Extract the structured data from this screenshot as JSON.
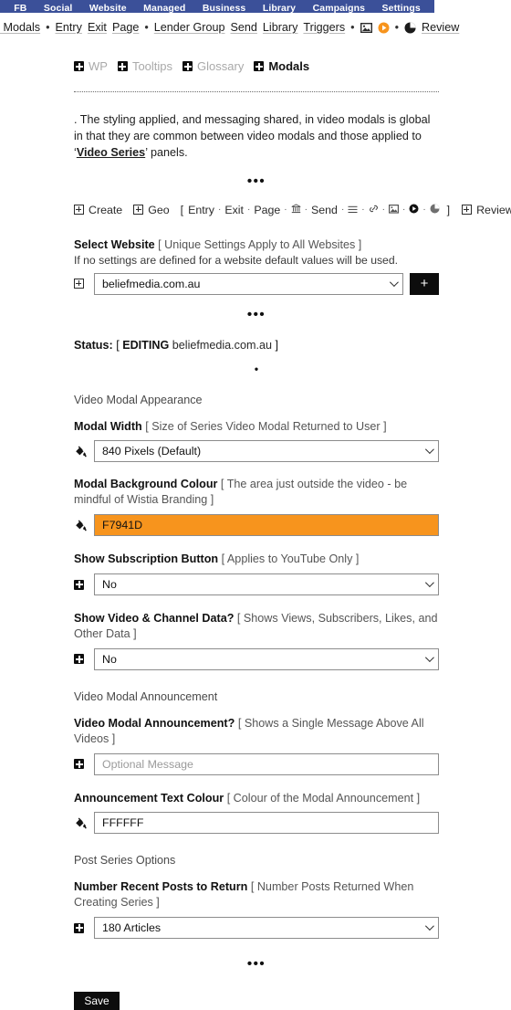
{
  "topnav": {
    "items": [
      "FB",
      "Social",
      "Website",
      "Managed",
      "Business",
      "Library",
      "Campaigns",
      "Settings"
    ]
  },
  "subnav": {
    "items": [
      {
        "type": "link",
        "label": "eo Modals"
      },
      {
        "type": "sep",
        "label": "•"
      },
      {
        "type": "link",
        "label": "Entry"
      },
      {
        "type": "link",
        "label": "Exit"
      },
      {
        "type": "link",
        "label": "Page"
      },
      {
        "type": "sep",
        "label": "•"
      },
      {
        "type": "link",
        "label": "Lender Group"
      },
      {
        "type": "link",
        "label": "Send"
      },
      {
        "type": "link",
        "label": "Library"
      },
      {
        "type": "link",
        "label": "Triggers"
      },
      {
        "type": "sep",
        "label": "•"
      },
      {
        "type": "icon",
        "label": "image-icon"
      },
      {
        "type": "icon",
        "label": "play-circle-icon"
      },
      {
        "type": "sep",
        "label": "•"
      },
      {
        "type": "icon",
        "label": "pie-chart-icon"
      },
      {
        "type": "link",
        "label": "Review"
      }
    ]
  },
  "tabs": [
    {
      "label": "WP",
      "active": false
    },
    {
      "label": "Tooltips",
      "active": false
    },
    {
      "label": "Glossary",
      "active": false
    },
    {
      "label": "Modals",
      "active": true
    }
  ],
  "intro": {
    "before": ". The styling applied, and messaging shared, in video modals is global in that they are common between video modals and those applied to ‘",
    "link": "Video Series",
    "after": "’ panels."
  },
  "dots": {
    "three": "•••",
    "one": "•"
  },
  "actions": {
    "create": "Create",
    "geo": "Geo",
    "bracket_open": "[",
    "bracket_close": "]",
    "entry": "Entry",
    "exit": "Exit",
    "page": "Page",
    "bank_icon": "bank-icon",
    "send": "Send",
    "list_icon": "list-icon",
    "link_icon": "link-icon",
    "image_icon": "image-icon",
    "play_icon": "play-circle-icon",
    "pie_icon": "pie-chart-icon",
    "review": "Review",
    "dot": "·"
  },
  "select_website": {
    "label": "Select Website",
    "hint": "[ Unique Settings Apply to All Websites ]",
    "subtext": "If no settings are defined for a website default values will be used.",
    "value": "beliefmedia.com.au",
    "add_label": "+"
  },
  "status": {
    "label": "Status:",
    "open": "[",
    "state": "EDITING",
    "site": "beliefmedia.com.au",
    "close": "]"
  },
  "appearance": {
    "section_title": "Video Modal Appearance",
    "modal_width": {
      "label": "Modal Width",
      "hint": "[ Size of Series Video Modal Returned to User ]",
      "value": "840 Pixels (Default)"
    },
    "modal_bg": {
      "label": "Modal Background Colour",
      "hint": "[ The area just outside the video - be mindful of Wistia Branding ]",
      "value": "F7941D",
      "color": "#F7941D"
    },
    "subscription": {
      "label": "Show Subscription Button",
      "hint": "[ Applies to YouTube Only ]",
      "value": "No"
    },
    "channel_data": {
      "label": "Show Video & Channel Data?",
      "hint": "[ Shows Views, Subscribers, Likes, and Other Data ]",
      "value": "No"
    }
  },
  "announcement": {
    "section_title": "Video Modal Announcement",
    "message": {
      "label": "Video Modal Announcement?",
      "hint": "[ Shows a Single Message Above All Videos ]",
      "value": "",
      "placeholder": "Optional Message"
    },
    "text_colour": {
      "label": "Announcement Text Colour",
      "hint": "[ Colour of the Modal Announcement ]",
      "value": "FFFFFF"
    }
  },
  "post_series": {
    "section_title": "Post Series Options",
    "recent_posts": {
      "label": "Number Recent Posts to Return",
      "hint": "[ Number Posts Returned When Creating Series ]",
      "value": "180 Articles"
    }
  },
  "footer": {
    "save_label": "Save"
  },
  "colors": {
    "nav_blue": "#3B5099",
    "accent_orange": "#F7941D",
    "black": "#0D0D0D"
  }
}
